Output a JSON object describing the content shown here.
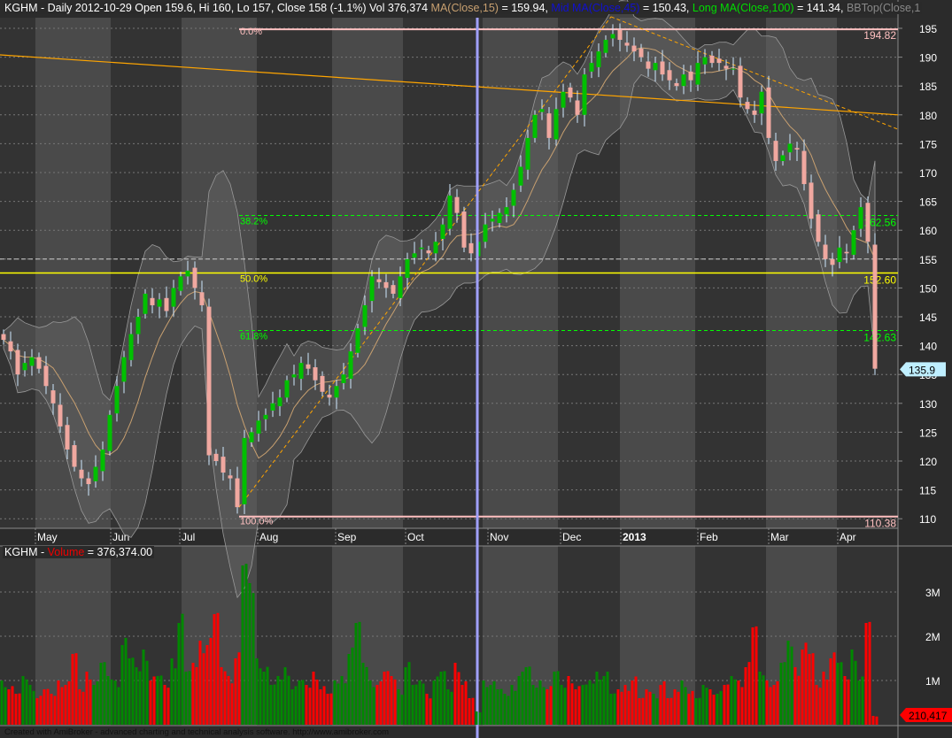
{
  "header": {
    "ticker": "KGHM",
    "info": "KGHM - Daily 2012-10-29 Open 159.6, Hi 160, Lo 157, Close 158 (-1.1%) Vol 376,374",
    "ma_label": "MA(Close,15)",
    "ma_value": " = 159.94, ",
    "mid_label": "Mid MA(Close,45)",
    "mid_value": " = 150.43, ",
    "long_label": "Long MA(Close,100)",
    "long_value": " = 141.34, ",
    "bb_label": "BBTop(Close,1"
  },
  "volume_header": {
    "ticker": "KGHM - ",
    "label": "Volume",
    "value": " = 376,374.00"
  },
  "footer": "Created with AmiBroker - advanced charting and technical analysis software. http://www.amibroker.com",
  "colors": {
    "up": "#00c000",
    "down": "#f0a8a0",
    "ma": "#c8a070",
    "fib_line": "#ffc0c0",
    "fib_text": "#00ff00",
    "yellow": "#ffff00",
    "trend": "#ffa500",
    "cursor": "#a0a0ff",
    "vol_up": "#008800",
    "vol_down": "#ff0000"
  },
  "chart_data": [
    {
      "type": "candlestick",
      "title": "KGHM - Daily",
      "x_labels": [
        "May",
        "Jun",
        "Jul",
        "Aug",
        "Sep",
        "Oct",
        "Nov",
        "Dec",
        "2013",
        "Feb",
        "Mar",
        "Apr"
      ],
      "y_ticks": [
        110,
        115,
        120,
        125,
        130,
        135,
        140,
        145,
        150,
        155,
        160,
        165,
        170,
        175,
        180,
        185,
        190,
        195
      ],
      "ylim": [
        108,
        197
      ],
      "last_price": "135.9",
      "fibonacci": [
        {
          "label": "0.0%",
          "value": "194.82"
        },
        {
          "label": "38.2%",
          "value": "162.56"
        },
        {
          "label": "50.0%",
          "value": "152.60"
        },
        {
          "label": "61.8%",
          "value": "142.63"
        },
        {
          "label": "100.0%",
          "value": "110.38"
        }
      ],
      "close": [
        141,
        139,
        135,
        137,
        138,
        136,
        133,
        130,
        126,
        122,
        119,
        117,
        116,
        119,
        122,
        128,
        133,
        138,
        142,
        145,
        149,
        147,
        148,
        146,
        150,
        152,
        153,
        150,
        147,
        121,
        120,
        118,
        117,
        112,
        124,
        125,
        127,
        128,
        130,
        131,
        134,
        135,
        137,
        136,
        134,
        132,
        131,
        133,
        135,
        139,
        143,
        147,
        152,
        151,
        150,
        149,
        152,
        155,
        156,
        157,
        156,
        158,
        161,
        166,
        163,
        157,
        156,
        158,
        161,
        162,
        163,
        164,
        167,
        171,
        176,
        180,
        181,
        176,
        181,
        184,
        183,
        180,
        187,
        189,
        191,
        193,
        194,
        193,
        192,
        191,
        190,
        188,
        189,
        187,
        186,
        185,
        187,
        186,
        189,
        190,
        189,
        189,
        188,
        188,
        183,
        181,
        180,
        184,
        176,
        172,
        173,
        175,
        174,
        168,
        162,
        158,
        155,
        154,
        157,
        156,
        160,
        164,
        158,
        136
      ]
    },
    {
      "type": "bar",
      "title": "Volume",
      "y_ticks": [
        "1M",
        "2M",
        "3M"
      ],
      "ylim": [
        0,
        4
      ],
      "last_volume": "210,417",
      "volume_millions": [
        1.0,
        0.8,
        0.7,
        1.1,
        0.9,
        0.6,
        0.8,
        0.7,
        1.0,
        0.9,
        1.6,
        0.8,
        1.2,
        0.9,
        1.4,
        1.1,
        1.0,
        1.8,
        1.5,
        1.3,
        1.7,
        1.0,
        1.1,
        0.9,
        1.5,
        2.3,
        1.2,
        1.4,
        1.9,
        1.8,
        2.5,
        1.3,
        1.1,
        1.5,
        3.6,
        3.2,
        1.5,
        1.2,
        0.9,
        1.1,
        1.3,
        0.8,
        1.0,
        0.9,
        1.2,
        0.8,
        0.7,
        1.0,
        1.1,
        1.6,
        2.3,
        1.4,
        1.0,
        0.9,
        1.2,
        1.1,
        0.8,
        1.3,
        0.9,
        1.0,
        0.7,
        1.0,
        1.2,
        0.8,
        1.4,
        0.9,
        0.6,
        0.3,
        1.0,
        0.9,
        0.8,
        0.7,
        0.9,
        1.1,
        1.3,
        0.9,
        1.0,
        0.8,
        1.2,
        0.9,
        1.1,
        0.8,
        0.9,
        1.0,
        1.2,
        1.1,
        0.7,
        0.8,
        0.9,
        1.0,
        0.6,
        0.8,
        0.7,
        0.9,
        0.6,
        0.8,
        1.0,
        0.7,
        0.6,
        0.9,
        0.8,
        0.7,
        0.9,
        1.1,
        1.0,
        1.3,
        2.2,
        1.2,
        1.0,
        0.9,
        1.4,
        1.9,
        1.3,
        1.7,
        1.6,
        0.9,
        1.2,
        1.5,
        1.4,
        1.1,
        1.7,
        1.0,
        2.3,
        0.2
      ]
    }
  ]
}
